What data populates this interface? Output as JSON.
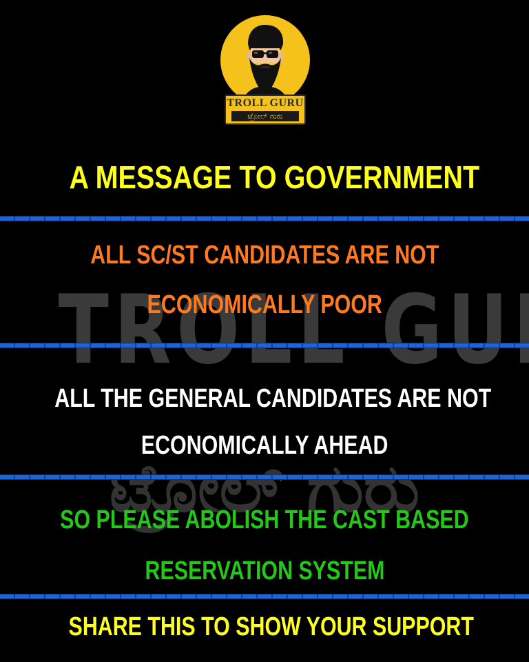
{
  "logo": {
    "badge_title": "TROLL GURU",
    "badge_subtitle": "ಟ್ರೋಲ್ ಗುರು",
    "accent_color": "#f5c21b",
    "icon": "bearded-man-sunglasses-icon"
  },
  "watermark": {
    "latin": "TROLL GURU",
    "kannada": "ಟ್ರೋಲ್ ಗುರು"
  },
  "headline": "A MESSAGE TO GOVERNMENT",
  "messages": [
    {
      "line1": "ALL SC/ST CANDIDATES ARE NOT",
      "line2": "ECONOMICALLY POOR",
      "color": "#ff7a1f"
    },
    {
      "line1": "ALL THE GENERAL CANDIDATES ARE NOT",
      "line2": "ECONOMICALLY AHEAD",
      "color": "#ffffff"
    },
    {
      "line1": "SO PLEASE ABOLISH THE CAST BASED",
      "line2": "RESERVATION SYSTEM",
      "color": "#25c71a"
    }
  ],
  "footer": "SHARE THIS TO SHOW YOUR SUPPORT",
  "colors": {
    "headline": "#ffff1e",
    "divider": "#1e64d6",
    "background": "#000000"
  }
}
